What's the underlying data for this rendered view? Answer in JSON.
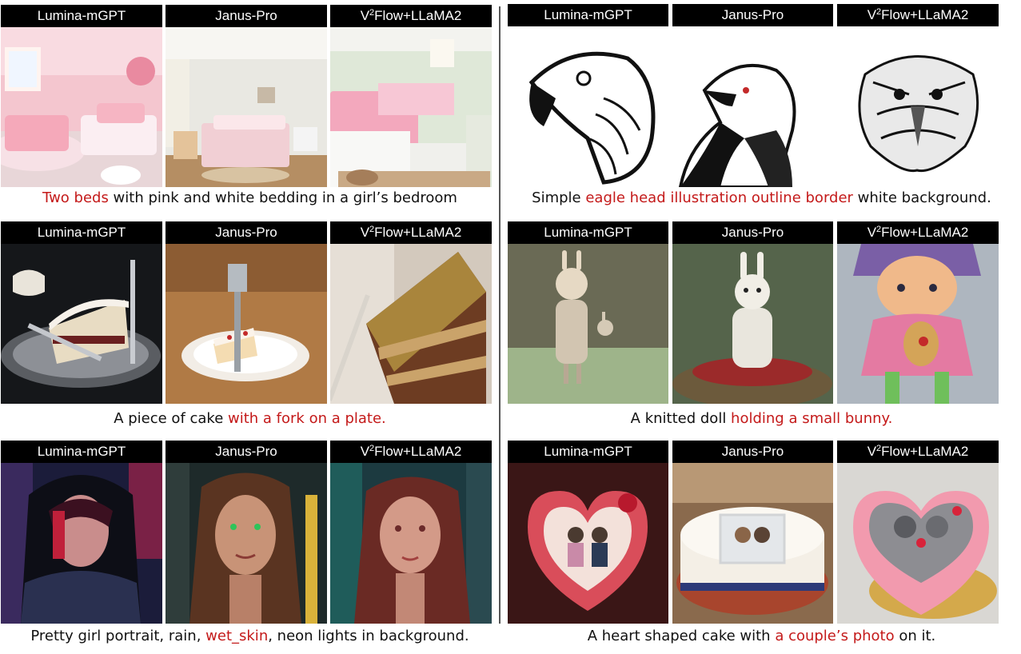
{
  "models": [
    "Lumina-mGPT",
    "Janus-Pro",
    "V²Flow+LLaMA2"
  ],
  "model3_parts": {
    "prefix": "V",
    "sup": "2",
    "suffix": "Flow+LLaMA2"
  },
  "panels": [
    {
      "id": "bedroom",
      "caption": [
        {
          "t": "Two beds",
          "hl": true
        },
        {
          "t": " with pink and white bedding in a girl’s bedroom",
          "hl": false
        }
      ]
    },
    {
      "id": "eagle",
      "caption": [
        {
          "t": "Simple ",
          "hl": false
        },
        {
          "t": "eagle head illustration outline border",
          "hl": true
        },
        {
          "t": " white background.",
          "hl": false
        }
      ]
    },
    {
      "id": "cake",
      "caption": [
        {
          "t": "A piece of cake ",
          "hl": false
        },
        {
          "t": "with a fork on a plate.",
          "hl": true
        }
      ]
    },
    {
      "id": "doll",
      "caption": [
        {
          "t": "A knitted doll ",
          "hl": false
        },
        {
          "t": "holding a small bunny.",
          "hl": true
        }
      ]
    },
    {
      "id": "portrait",
      "caption": [
        {
          "t": "Pretty girl portrait, rain, ",
          "hl": false
        },
        {
          "t": "wet_skin",
          "hl": true
        },
        {
          "t": ", neon lights in background.",
          "hl": false
        }
      ]
    },
    {
      "id": "heartcake",
      "caption": [
        {
          "t": "A heart shaped cake with ",
          "hl": false
        },
        {
          "t": "a couple’s photo",
          "hl": true
        },
        {
          "t": " on it.",
          "hl": false
        }
      ]
    }
  ],
  "colors": {
    "highlight": "#c41a1a",
    "header_bg": "#000000",
    "header_text": "#ffffff"
  }
}
